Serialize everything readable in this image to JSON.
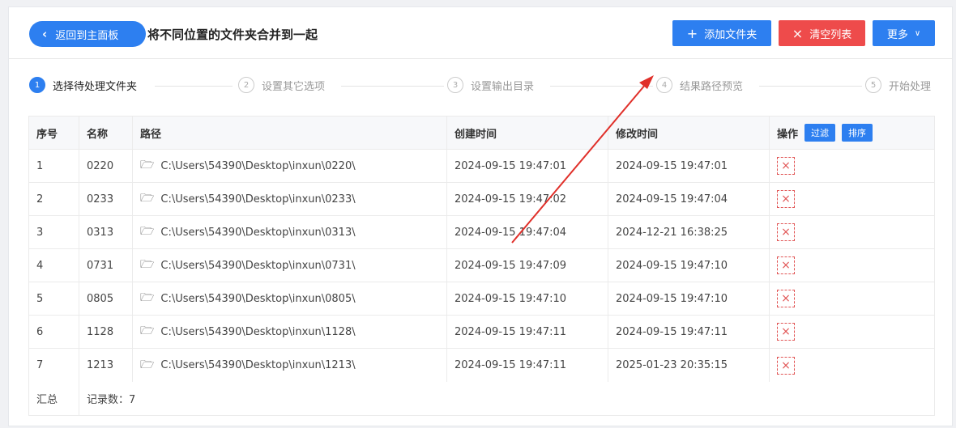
{
  "header": {
    "back_label": "返回到主面板",
    "title": "将不同位置的文件夹合并到一起",
    "add_label": "添加文件夹",
    "clear_label": "清空列表",
    "more_label": "更多"
  },
  "steps": [
    {
      "num": "1",
      "label": "选择待处理文件夹"
    },
    {
      "num": "2",
      "label": "设置其它选项"
    },
    {
      "num": "3",
      "label": "设置输出目录"
    },
    {
      "num": "4",
      "label": "结果路径预览"
    },
    {
      "num": "5",
      "label": "开始处理"
    }
  ],
  "table": {
    "headers": {
      "index": "序号",
      "name": "名称",
      "path": "路径",
      "created": "创建时间",
      "modified": "修改时间",
      "op": "操作",
      "filter": "过滤",
      "sort": "排序"
    },
    "rows": [
      {
        "index": "1",
        "name": "0220",
        "path": "C:\\Users\\54390\\Desktop\\inxun\\0220\\",
        "created": "2024-09-15 19:47:01",
        "modified": "2024-09-15 19:47:01"
      },
      {
        "index": "2",
        "name": "0233",
        "path": "C:\\Users\\54390\\Desktop\\inxun\\0233\\",
        "created": "2024-09-15 19:47:02",
        "modified": "2024-09-15 19:47:04"
      },
      {
        "index": "3",
        "name": "0313",
        "path": "C:\\Users\\54390\\Desktop\\inxun\\0313\\",
        "created": "2024-09-15 19:47:04",
        "modified": "2024-12-21 16:38:25"
      },
      {
        "index": "4",
        "name": "0731",
        "path": "C:\\Users\\54390\\Desktop\\inxun\\0731\\",
        "created": "2024-09-15 19:47:09",
        "modified": "2024-09-15 19:47:10"
      },
      {
        "index": "5",
        "name": "0805",
        "path": "C:\\Users\\54390\\Desktop\\inxun\\0805\\",
        "created": "2024-09-15 19:47:10",
        "modified": "2024-09-15 19:47:10"
      },
      {
        "index": "6",
        "name": "1128",
        "path": "C:\\Users\\54390\\Desktop\\inxun\\1128\\",
        "created": "2024-09-15 19:47:11",
        "modified": "2024-09-15 19:47:11"
      },
      {
        "index": "7",
        "name": "1213",
        "path": "C:\\Users\\54390\\Desktop\\inxun\\1213\\",
        "created": "2024-09-15 19:47:11",
        "modified": "2025-01-23 20:35:15"
      }
    ],
    "summary_label": "汇总",
    "summary_value": "记录数：7"
  },
  "colors": {
    "primary": "#2d7ff0",
    "danger": "#ee4b4b",
    "annotation_arrow": "#e0302a"
  }
}
